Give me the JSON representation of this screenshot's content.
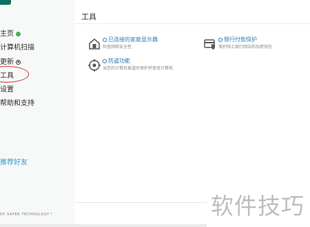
{
  "sidebar": {
    "items": [
      {
        "label": "主页",
        "badge": "green-dot"
      },
      {
        "label": "计算机扫描"
      },
      {
        "label": "更新",
        "badge": "ring-dot"
      },
      {
        "label": "工具"
      },
      {
        "label": "设置"
      },
      {
        "label": "帮助和支持"
      }
    ],
    "refer_friend": "推荐好友",
    "brand": "DY SAFER TECHNOLOGY™"
  },
  "main": {
    "title": "工具",
    "tools": [
      {
        "icon": "home-network-icon",
        "title": "已连接的家庭显示器",
        "desc": "检查网络安全性"
      },
      {
        "icon": "banking-protection-icon",
        "title": "银行付款保护",
        "desc": "保护网上银行网站和加密钱包"
      },
      {
        "icon": "anti-theft-icon",
        "title": "防盗功能",
        "desc": "当您的计算机被盗时保护并查找计算机"
      }
    ]
  },
  "watermark": "软件技巧",
  "colors": {
    "accent": "#0f6e62",
    "link": "#2a7ab8",
    "annotation": "#d93636"
  }
}
